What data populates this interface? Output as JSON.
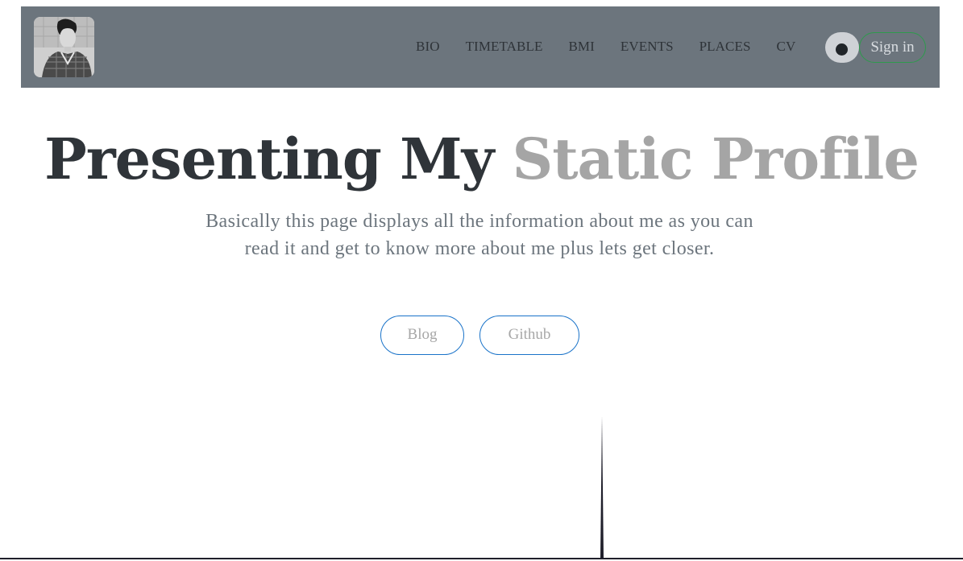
{
  "navbar": {
    "avatar_alt": "profile photo",
    "links": [
      {
        "label": "BIO"
      },
      {
        "label": "TIMETABLE"
      },
      {
        "label": "BMI"
      },
      {
        "label": "EVENTS"
      },
      {
        "label": "PLACES"
      },
      {
        "label": "CV"
      }
    ],
    "theme_toggle_icon": "circle-dot-icon",
    "signin_label": "Sign in"
  },
  "hero": {
    "title_main": "Presenting My",
    "title_accent": "Static Profile",
    "subtitle": "Basically this page displays all the information about me as you can read it and get to know more about me plus lets get closer.",
    "buttons": {
      "blog": "Blog",
      "github": "Github"
    }
  },
  "colors": {
    "navbar_bg": "#6c757d",
    "title": "#2f3439",
    "title_accent": "#a5a5a5",
    "subtitle": "#6c757d",
    "pill_border": "#1a73c9",
    "signin_border": "#2e9a4d"
  }
}
